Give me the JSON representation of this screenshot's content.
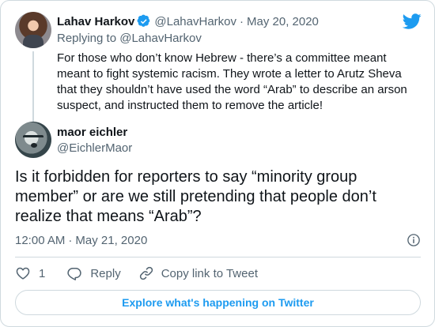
{
  "parent_tweet": {
    "display_name": "Lahav Harkov",
    "handle": "@LahavHarkov",
    "date": "May 20, 2020",
    "replying_to_prefix": "Replying to",
    "replying_to_handle": "@LahavHarkov",
    "text": "For those who don’t know Hebrew - there’s a committee meant meant to fight systemic racism. They wrote a letter to Arutz Sheva that they shouldn’t have used the word “Arab” to describe an arson suspect, and instructed them to remove the article!"
  },
  "main_tweet": {
    "display_name": "maor eichler",
    "handle": "@EichlerMaor",
    "text": "Is it forbidden for reporters to say “minority group member” or are we still pretending that people don’t realize that means “Arab”?",
    "time": "12:00 AM",
    "date": "May 21, 2020"
  },
  "actions": {
    "like_count": "1",
    "reply_label": "Reply",
    "copy_link_label": "Copy link to Tweet"
  },
  "footer": {
    "explore_label": "Explore what's happening on Twitter"
  },
  "icons": {
    "brand": "twitter-bird-icon",
    "verified": "verified-badge-icon",
    "info": "info-icon",
    "like": "heart-icon",
    "reply": "reply-icon",
    "copy_link": "link-icon"
  },
  "colors": {
    "twitter_blue": "#1d9bf0",
    "text_primary": "#0f1419",
    "text_secondary": "#536471",
    "border": "#cfd9de"
  }
}
